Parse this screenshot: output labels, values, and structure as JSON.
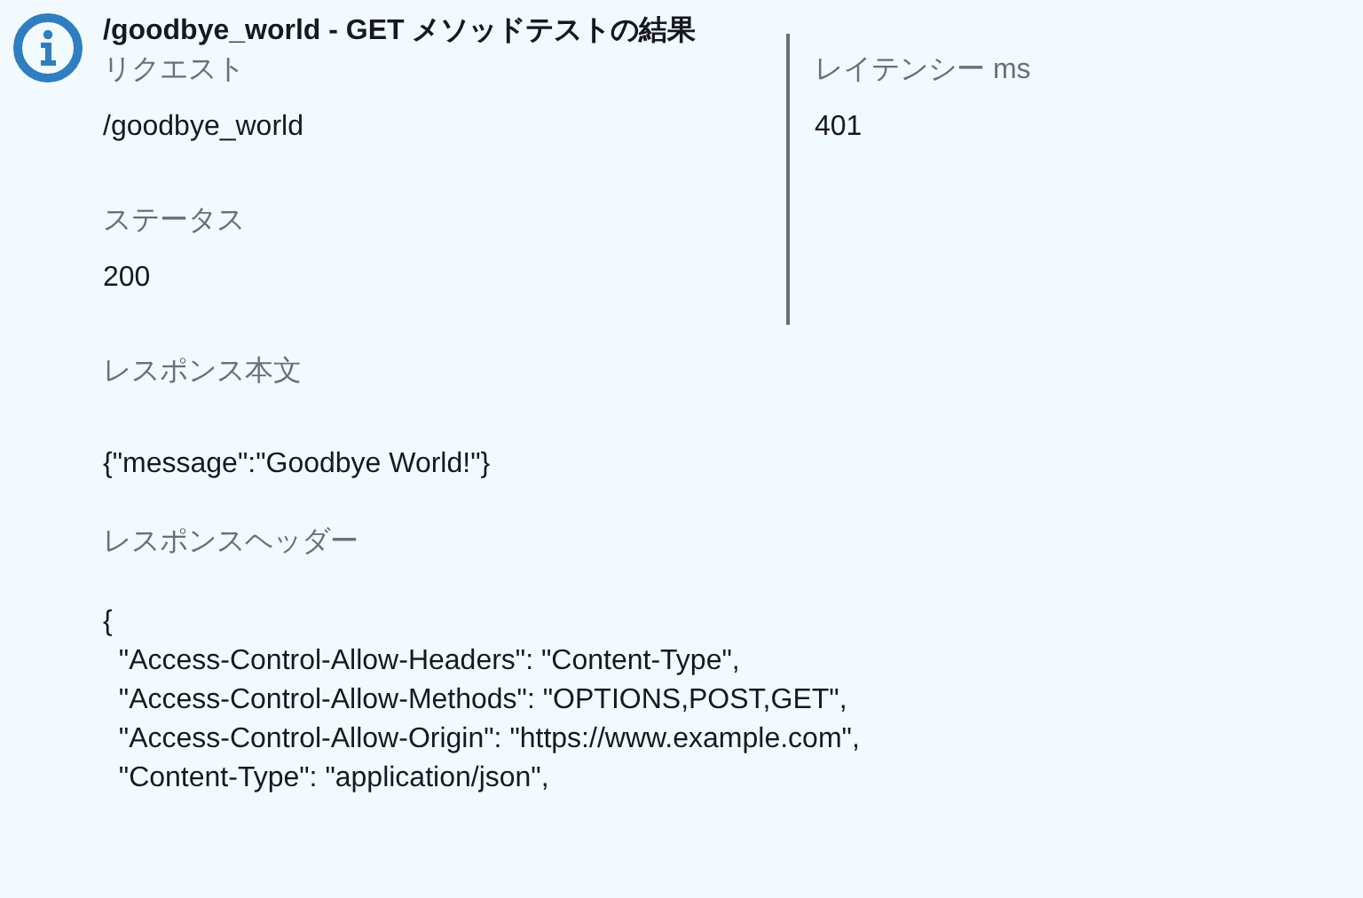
{
  "title": "/goodbye_world - GET メソッドテストの結果",
  "summary": {
    "left": [
      {
        "label": "リクエスト",
        "value": "/goodbye_world"
      },
      {
        "label": "ステータス",
        "value": "200"
      }
    ],
    "right": [
      {
        "label": "レイテンシー ms",
        "value": "401"
      }
    ]
  },
  "sections": [
    {
      "kind": "text",
      "label": "レスポンス本文",
      "lines": [
        "{\"message\":\"Goodbye World!\"}"
      ]
    },
    {
      "kind": "json",
      "label": "レスポンスヘッダー",
      "lines": [
        "{",
        "  \"Access-Control-Allow-Headers\": \"Content-Type\",",
        "  \"Access-Control-Allow-Methods\": \"OPTIONS,POST,GET\",",
        "  \"Access-Control-Allow-Origin\": \"https://www.example.com\",",
        "  \"Content-Type\": \"application/json\","
      ]
    }
  ]
}
